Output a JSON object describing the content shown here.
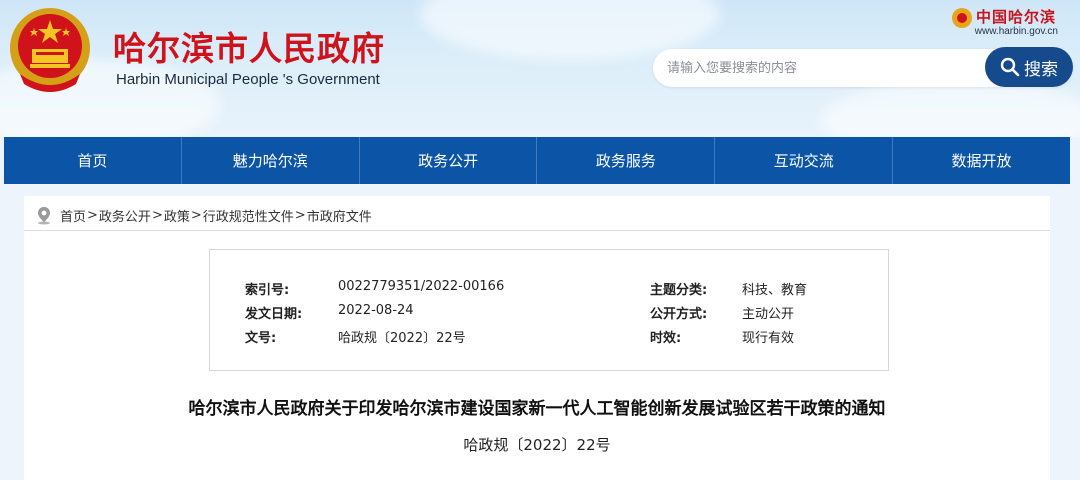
{
  "header": {
    "site_title": "哈尔滨市人民政府",
    "site_subtitle": "Harbin Municipal People 's Government",
    "brand": "中国哈尔滨",
    "domain": "www.harbin.gov.cn",
    "search_placeholder": "请输入您要搜索的内容",
    "search_button": "搜索"
  },
  "nav": [
    "首页",
    "魅力哈尔滨",
    "政务公开",
    "政务服务",
    "互动交流",
    "数据开放"
  ],
  "breadcrumb": [
    "首页",
    "政务公开",
    "政策",
    "行政规范性文件",
    "市政府文件"
  ],
  "breadcrumb_separator": ">",
  "info": {
    "index_no_label": "索引号:",
    "index_no": "0022779351/2022-00166",
    "topic_label": "主题分类:",
    "topic": "科技、教育",
    "date_label": "发文日期:",
    "date": "2022-08-24",
    "public_label": "公开方式:",
    "public": "主动公开",
    "doc_no_label": "文号:",
    "doc_no": "哈政规〔2022〕22号",
    "validity_label": "时效:",
    "validity": "现行有效"
  },
  "document": {
    "title": "哈尔滨市人民政府关于印发哈尔滨市建设国家新一代人工智能创新发展试验区若干政策的通知",
    "number": "哈政规〔2022〕22号"
  },
  "colors": {
    "nav_bg": "#0c55a6",
    "title_red": "#d0121b",
    "search_button": "#154b8c"
  }
}
